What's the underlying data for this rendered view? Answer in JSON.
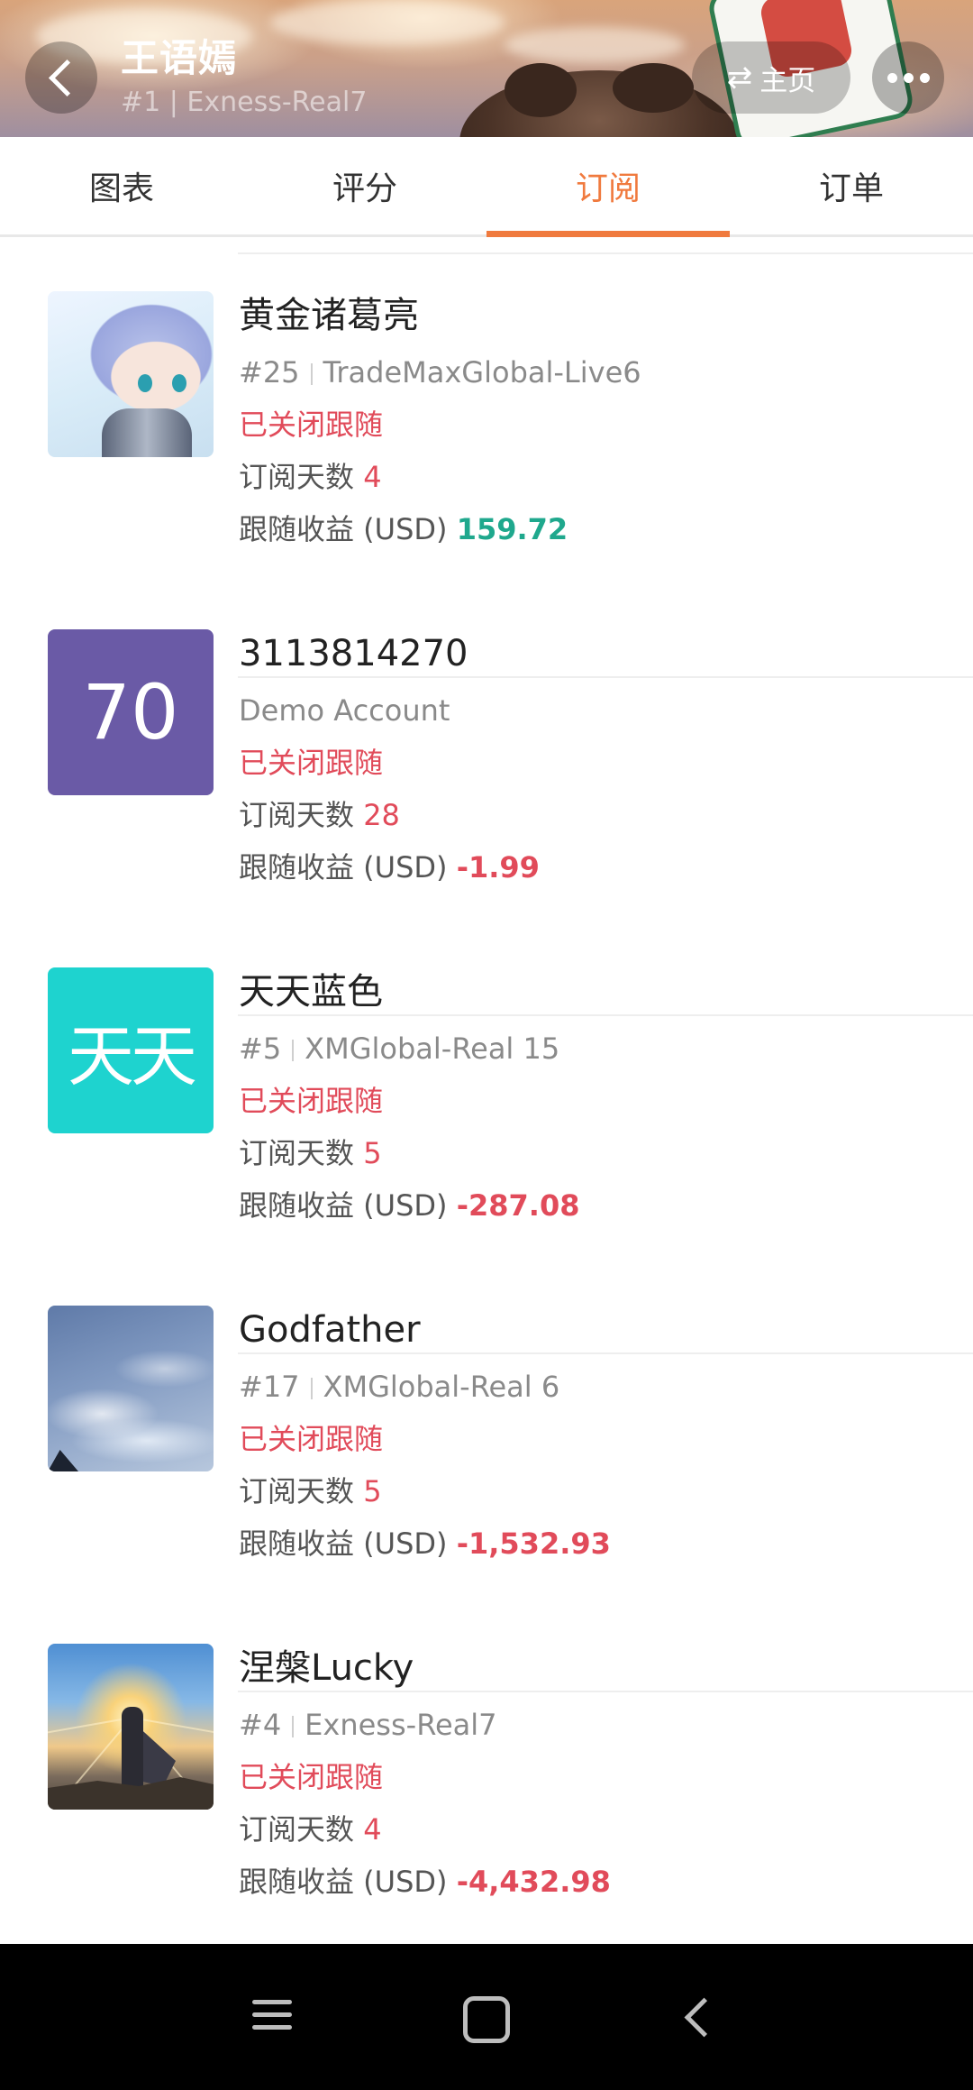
{
  "header": {
    "title": "王语嫣",
    "subtitle": "#1 | Exness-Real7",
    "home_label": "主页",
    "back_icon": "chevron-left-icon",
    "swap_icon": "swap-icon",
    "more_icon": "more-dots-icon"
  },
  "tabs": [
    {
      "label": "图表",
      "active": false
    },
    {
      "label": "评分",
      "active": false
    },
    {
      "label": "订阅",
      "active": true
    },
    {
      "label": "订单",
      "active": false
    }
  ],
  "labels": {
    "days": "订阅天数",
    "profit": "跟随收益 (USD)"
  },
  "subscriptions": [
    {
      "name": "黄金诸葛亮",
      "rank": "#25",
      "server": "TradeMaxGlobal-Live6",
      "status": "已关闭跟随",
      "days": "4",
      "profit": "159.72",
      "profit_color": "#1fa88d"
    },
    {
      "name": "3113814270",
      "rank": "",
      "server": "Demo Account",
      "status": "已关闭跟随",
      "days": "28",
      "profit": "-1.99",
      "avatar_text": "70",
      "profit_color": "#e14b5a"
    },
    {
      "name": "天天蓝色",
      "rank": "#5",
      "server": "XMGlobal-Real 15",
      "status": "已关闭跟随",
      "days": "5",
      "profit": "-287.08",
      "avatar_text": "天天",
      "profit_color": "#e14b5a"
    },
    {
      "name": "Godfather",
      "rank": "#17",
      "server": "XMGlobal-Real 6",
      "status": "已关闭跟随",
      "days": "5",
      "profit": "-1,532.93",
      "profit_color": "#e14b5a"
    },
    {
      "name": "涅槃Lucky",
      "rank": "#4",
      "server": "Exness-Real7",
      "status": "已关闭跟随",
      "days": "4",
      "profit": "-4,432.98",
      "profit_color": "#e14b5a"
    }
  ],
  "colors": {
    "accent": "#f07a3e",
    "negative": "#e14b5a",
    "positive": "#1fa88d"
  }
}
